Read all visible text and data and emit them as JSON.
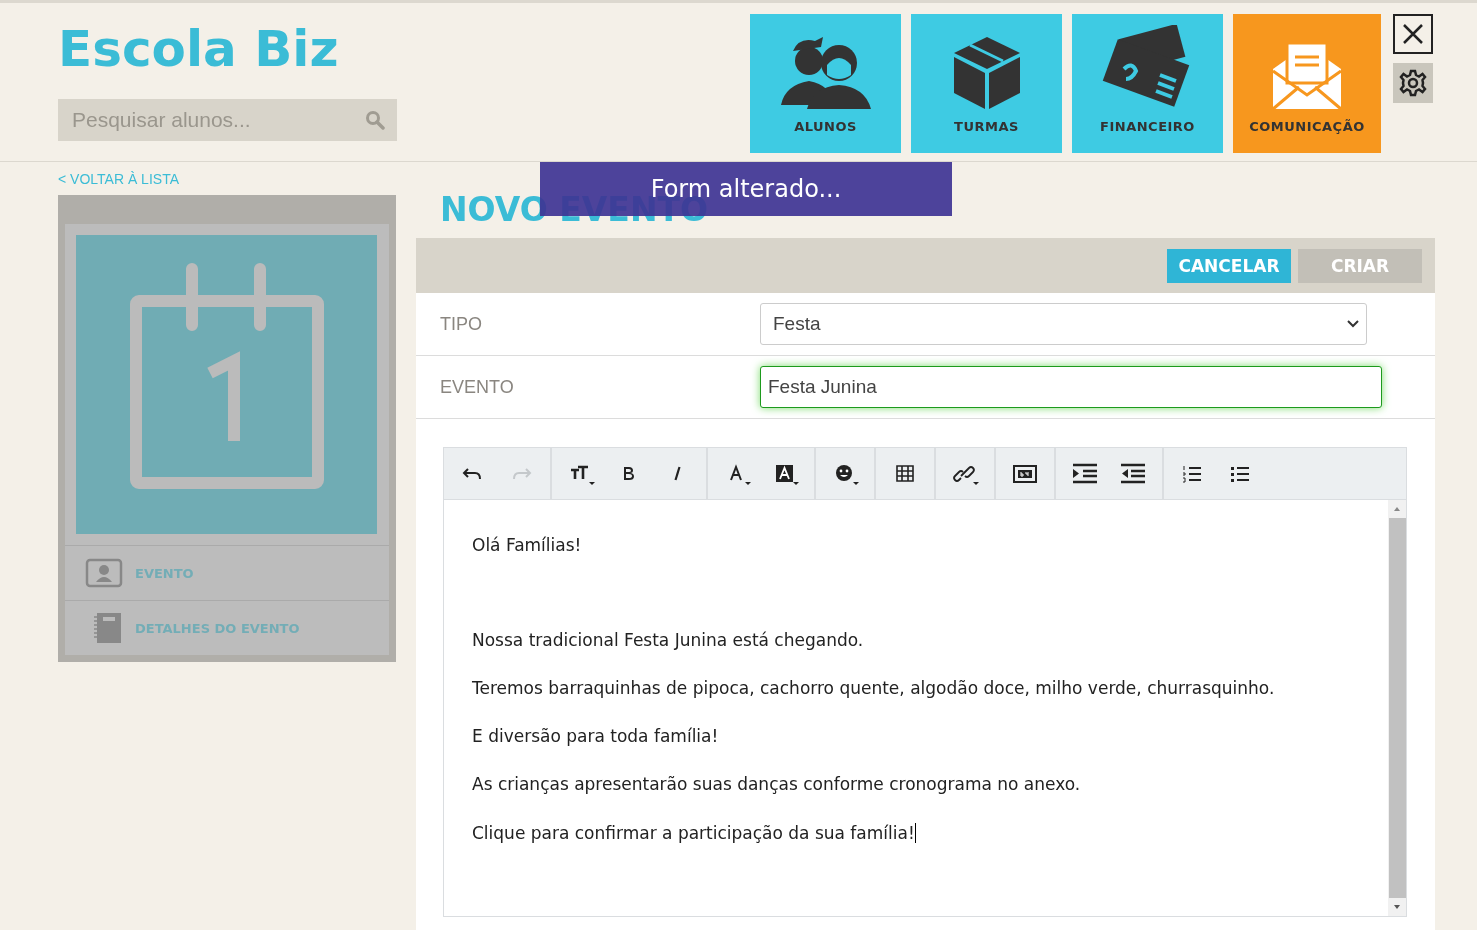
{
  "app": {
    "logo": "Escola Biz",
    "search": {
      "placeholder": "Pesquisar alunos..."
    }
  },
  "nav_tiles": [
    {
      "kind": "students",
      "label": "ALUNOS",
      "selected": false
    },
    {
      "kind": "classes",
      "label": "TURMAS",
      "selected": false
    },
    {
      "kind": "finance",
      "label": "FINANCEIRO",
      "selected": false
    },
    {
      "kind": "messages",
      "label": "COMUNICAÇÃO",
      "selected": true
    }
  ],
  "back_link": "< VOLTAR À LISTA",
  "sidebar": {
    "items": [
      {
        "kind": "person",
        "label": "EVENTO"
      },
      {
        "kind": "notebook",
        "label": "DETALHES DO EVENTO"
      }
    ]
  },
  "page_title": "NOVO EVENTO",
  "toast": "Form alterado...",
  "actions": [
    {
      "label": "CANCELAR",
      "disabled": false
    },
    {
      "label": "CRIAR",
      "disabled": true
    }
  ],
  "form": {
    "rows": [
      {
        "label": "TIPO",
        "kind": "select",
        "value": "Festa",
        "valid": false
      },
      {
        "label": "EVENTO",
        "kind": "input",
        "value": "Festa Junina",
        "valid": true
      }
    ]
  },
  "editor": {
    "toolbar": [
      [
        {
          "kind": "undo",
          "disabled": false
        },
        {
          "kind": "redo",
          "disabled": true
        }
      ],
      [
        {
          "kind": "font-size",
          "disabled": false
        },
        {
          "kind": "bold",
          "disabled": false
        },
        {
          "kind": "italic",
          "disabled": false
        }
      ],
      [
        {
          "kind": "text-color",
          "disabled": false
        },
        {
          "kind": "highlight",
          "disabled": false
        }
      ],
      [
        {
          "kind": "emoji",
          "disabled": false
        }
      ],
      [
        {
          "kind": "table",
          "disabled": false
        }
      ],
      [
        {
          "kind": "link",
          "disabled": false
        }
      ],
      [
        {
          "kind": "base64",
          "disabled": false
        }
      ],
      [
        {
          "kind": "indent",
          "disabled": false
        },
        {
          "kind": "outdent",
          "disabled": false
        }
      ],
      [
        {
          "kind": "ordered-list",
          "disabled": false
        },
        {
          "kind": "bullet-list",
          "disabled": false
        }
      ]
    ],
    "paragraphs": [
      "Olá Famílias!",
      "Nossa tradicional Festa Junina está chegando.",
      "Teremos barraquinhas de pipoca, cachorro quente, algodão doce, milho verde, churrasquinho.",
      "E diversão para toda família!",
      "As crianças apresentarão suas danças conforme cronograma no anexo.",
      "Clique para confirmar a participação da sua família!"
    ]
  }
}
